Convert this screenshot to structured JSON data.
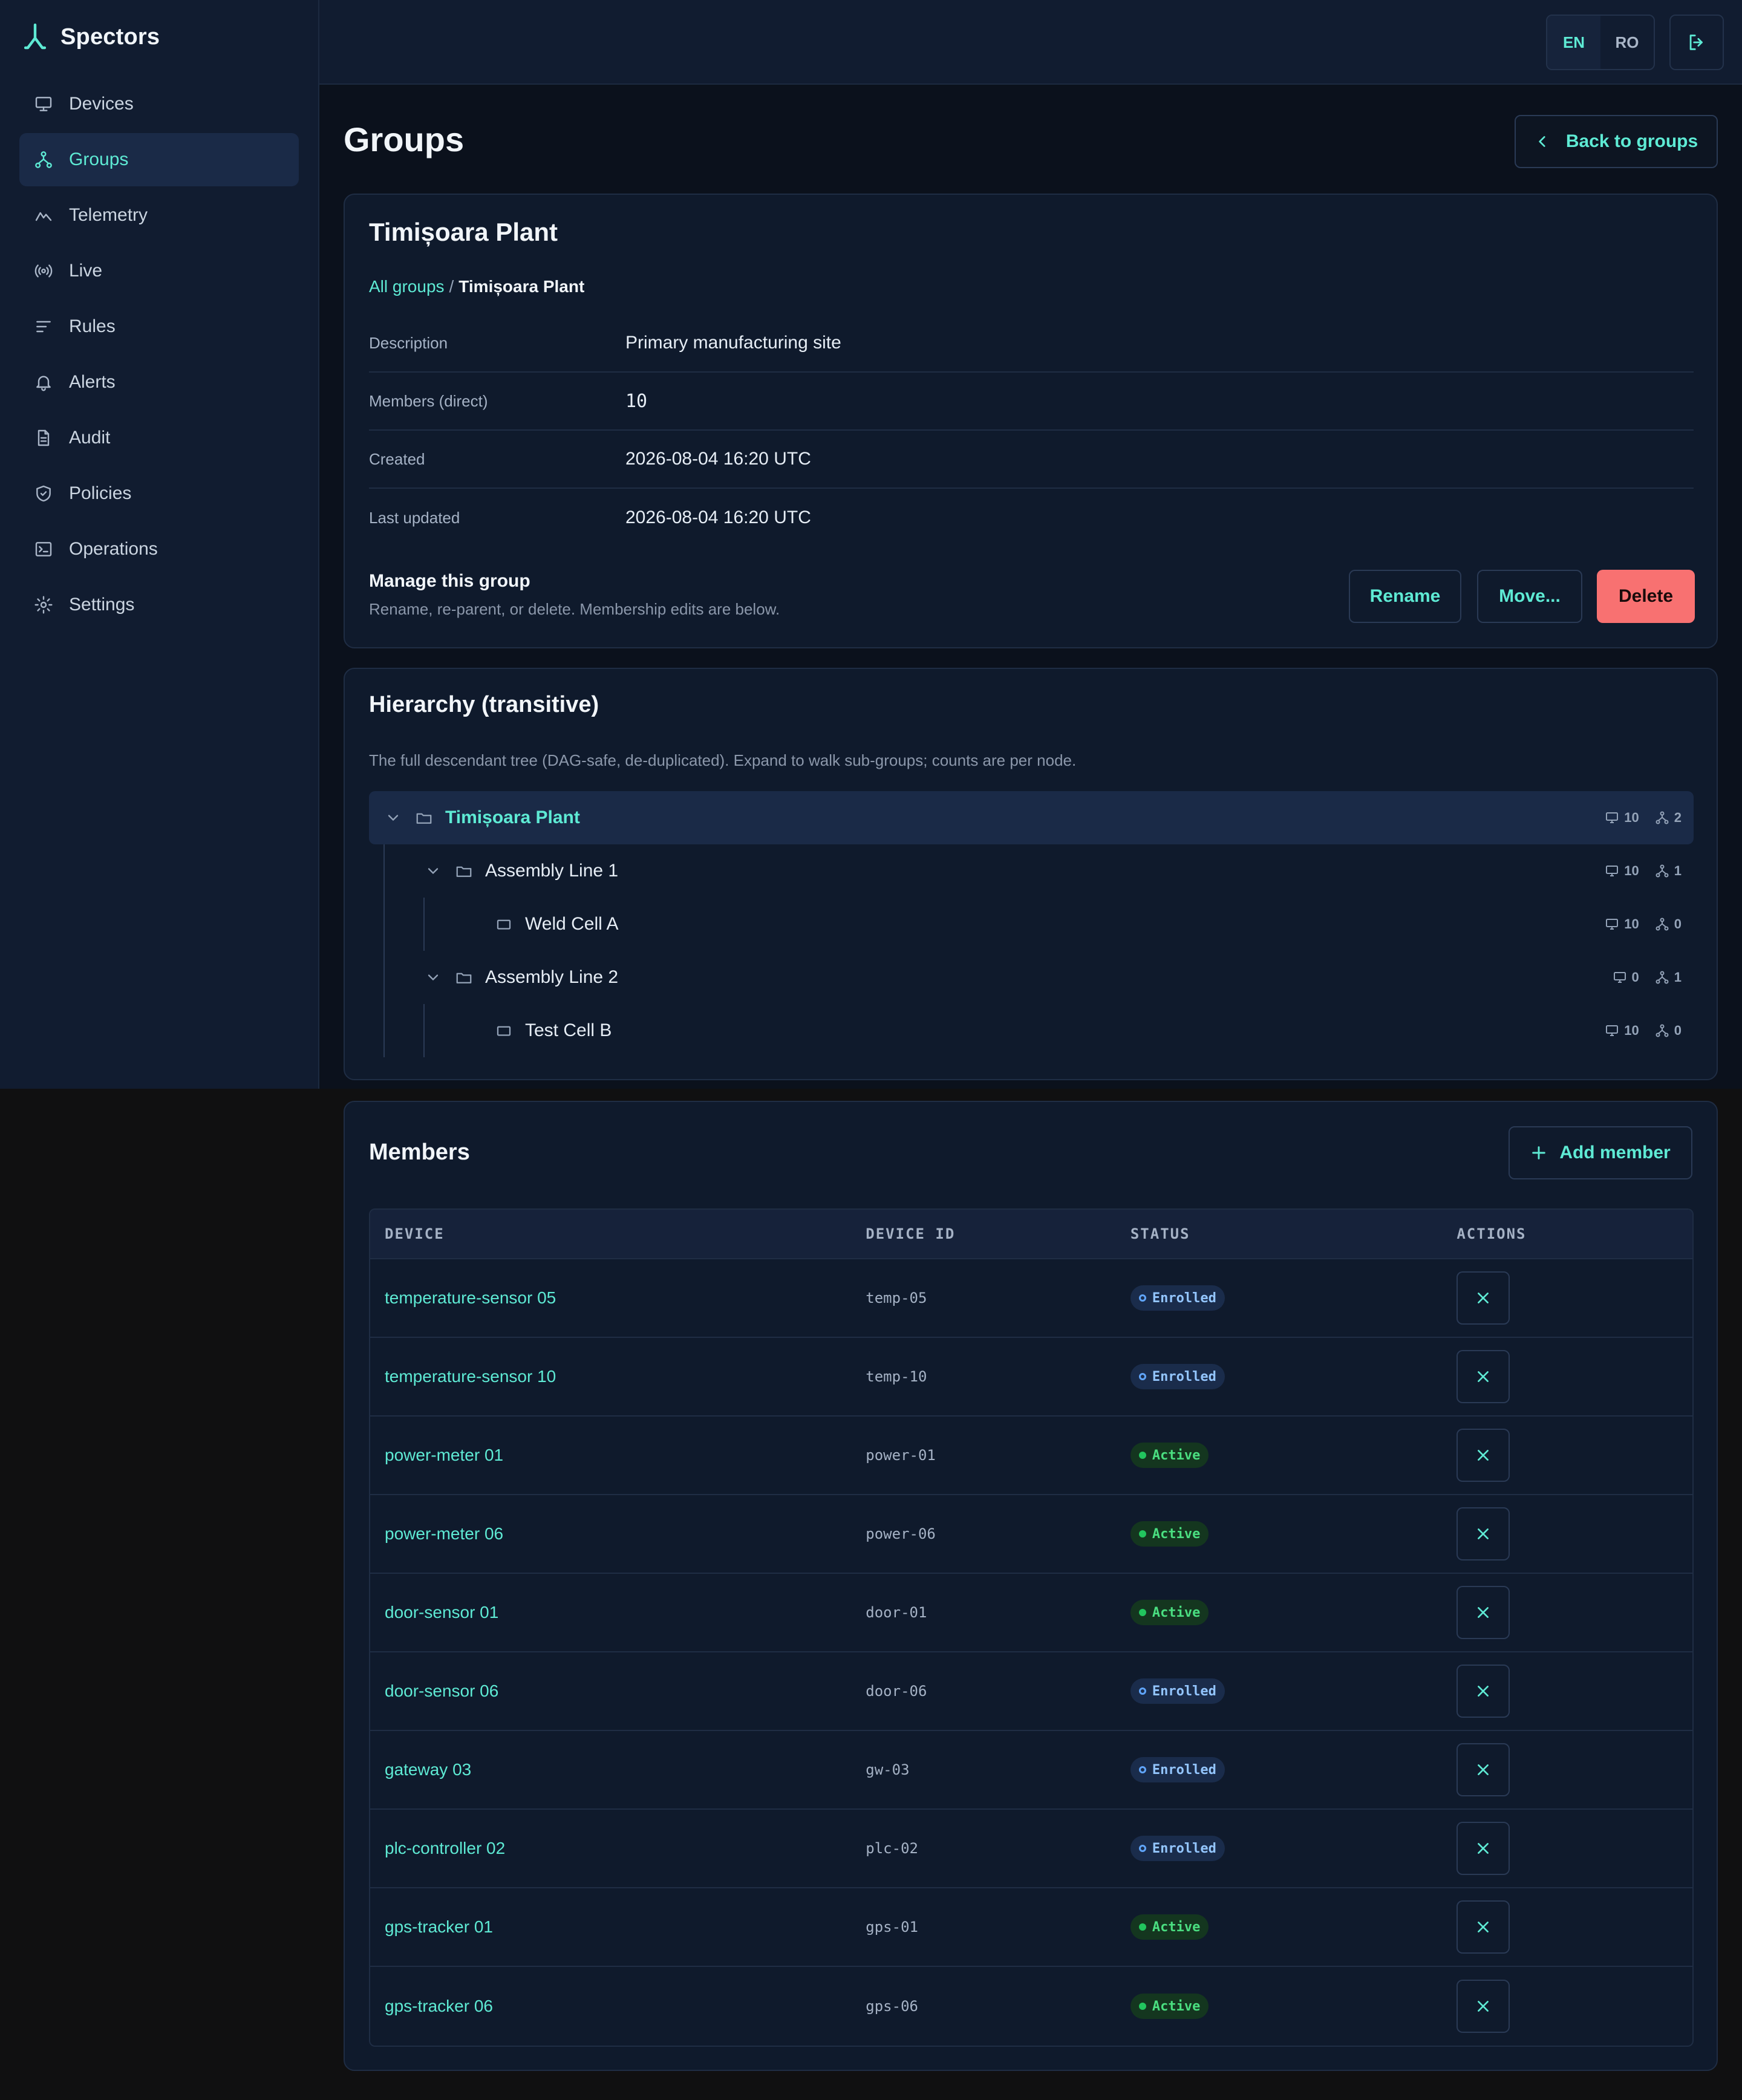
{
  "app": {
    "name": "Spectors"
  },
  "sidebar": {
    "items": [
      {
        "label": "Devices",
        "icon": "monitor-icon",
        "active": false
      },
      {
        "label": "Groups",
        "icon": "hierarchy-icon",
        "active": true
      },
      {
        "label": "Telemetry",
        "icon": "activity-icon",
        "active": false
      },
      {
        "label": "Live",
        "icon": "broadcast-icon",
        "active": false
      },
      {
        "label": "Rules",
        "icon": "lines-icon",
        "active": false
      },
      {
        "label": "Alerts",
        "icon": "bell-icon",
        "active": false
      },
      {
        "label": "Audit",
        "icon": "file-icon",
        "active": false
      },
      {
        "label": "Policies",
        "icon": "shield-icon",
        "active": false
      },
      {
        "label": "Operations",
        "icon": "terminal-icon",
        "active": false
      },
      {
        "label": "Settings",
        "icon": "gear-icon",
        "active": false
      }
    ]
  },
  "topbar": {
    "lang_en": "EN",
    "lang_ro": "RO",
    "active_lang": "EN"
  },
  "page": {
    "title": "Groups",
    "back_label": "Back to groups"
  },
  "group": {
    "name": "Timișoara Plant",
    "breadcrumb_root": "All groups",
    "breadcrumb_sep": "/",
    "breadcrumb_current": "Timișoara Plant",
    "fields": [
      {
        "key": "Description",
        "value": "Primary manufacturing site",
        "mono": false
      },
      {
        "key": "Members (direct)",
        "value": "10",
        "mono": true
      },
      {
        "key": "Created",
        "value": "2026-08-04 16:20 UTC",
        "mono": false
      },
      {
        "key": "Last updated",
        "value": "2026-08-04 16:20 UTC",
        "mono": false
      }
    ],
    "manage_title": "Manage this group",
    "manage_subtitle": "Rename, re-parent, or delete. Membership edits are below.",
    "rename_label": "Rename",
    "move_label": "Move...",
    "delete_label": "Delete"
  },
  "hierarchy": {
    "title": "Hierarchy (transitive)",
    "description": "The full descendant tree (DAG-safe, de-duplicated). Expand to walk sub-groups; counts are per node.",
    "nodes": [
      {
        "label": "Timișoara Plant",
        "depth": 0,
        "expandable": true,
        "devices": "10",
        "subgroups": "2"
      },
      {
        "label": "Assembly Line 1",
        "depth": 1,
        "expandable": true,
        "devices": "10",
        "subgroups": "1"
      },
      {
        "label": "Weld Cell A",
        "depth": 2,
        "expandable": false,
        "devices": "10",
        "subgroups": "0"
      },
      {
        "label": "Assembly Line 2",
        "depth": 1,
        "expandable": true,
        "devices": "0",
        "subgroups": "1"
      },
      {
        "label": "Test Cell B",
        "depth": 2,
        "expandable": false,
        "devices": "10",
        "subgroups": "0"
      }
    ]
  },
  "members": {
    "title": "Members",
    "add_label": "Add member",
    "columns": [
      "DEVICE",
      "DEVICE ID",
      "STATUS",
      "ACTIONS"
    ],
    "rows": [
      {
        "device": "temperature-sensor 05",
        "device_id": "temp-05",
        "status": "Enrolled"
      },
      {
        "device": "temperature-sensor 10",
        "device_id": "temp-10",
        "status": "Enrolled"
      },
      {
        "device": "power-meter 01",
        "device_id": "power-01",
        "status": "Active"
      },
      {
        "device": "power-meter 06",
        "device_id": "power-06",
        "status": "Active"
      },
      {
        "device": "door-sensor 01",
        "device_id": "door-01",
        "status": "Active"
      },
      {
        "device": "door-sensor 06",
        "device_id": "door-06",
        "status": "Enrolled"
      },
      {
        "device": "gateway 03",
        "device_id": "gw-03",
        "status": "Enrolled"
      },
      {
        "device": "plc-controller 02",
        "device_id": "plc-02",
        "status": "Enrolled"
      },
      {
        "device": "gps-tracker 01",
        "device_id": "gps-01",
        "status": "Active"
      },
      {
        "device": "gps-tracker 06",
        "device_id": "gps-06",
        "status": "Active"
      }
    ]
  },
  "colors": {
    "accent": "#5eead4",
    "danger": "#f87171",
    "active": "#22c55e",
    "enrolled": "#60a5fa"
  }
}
